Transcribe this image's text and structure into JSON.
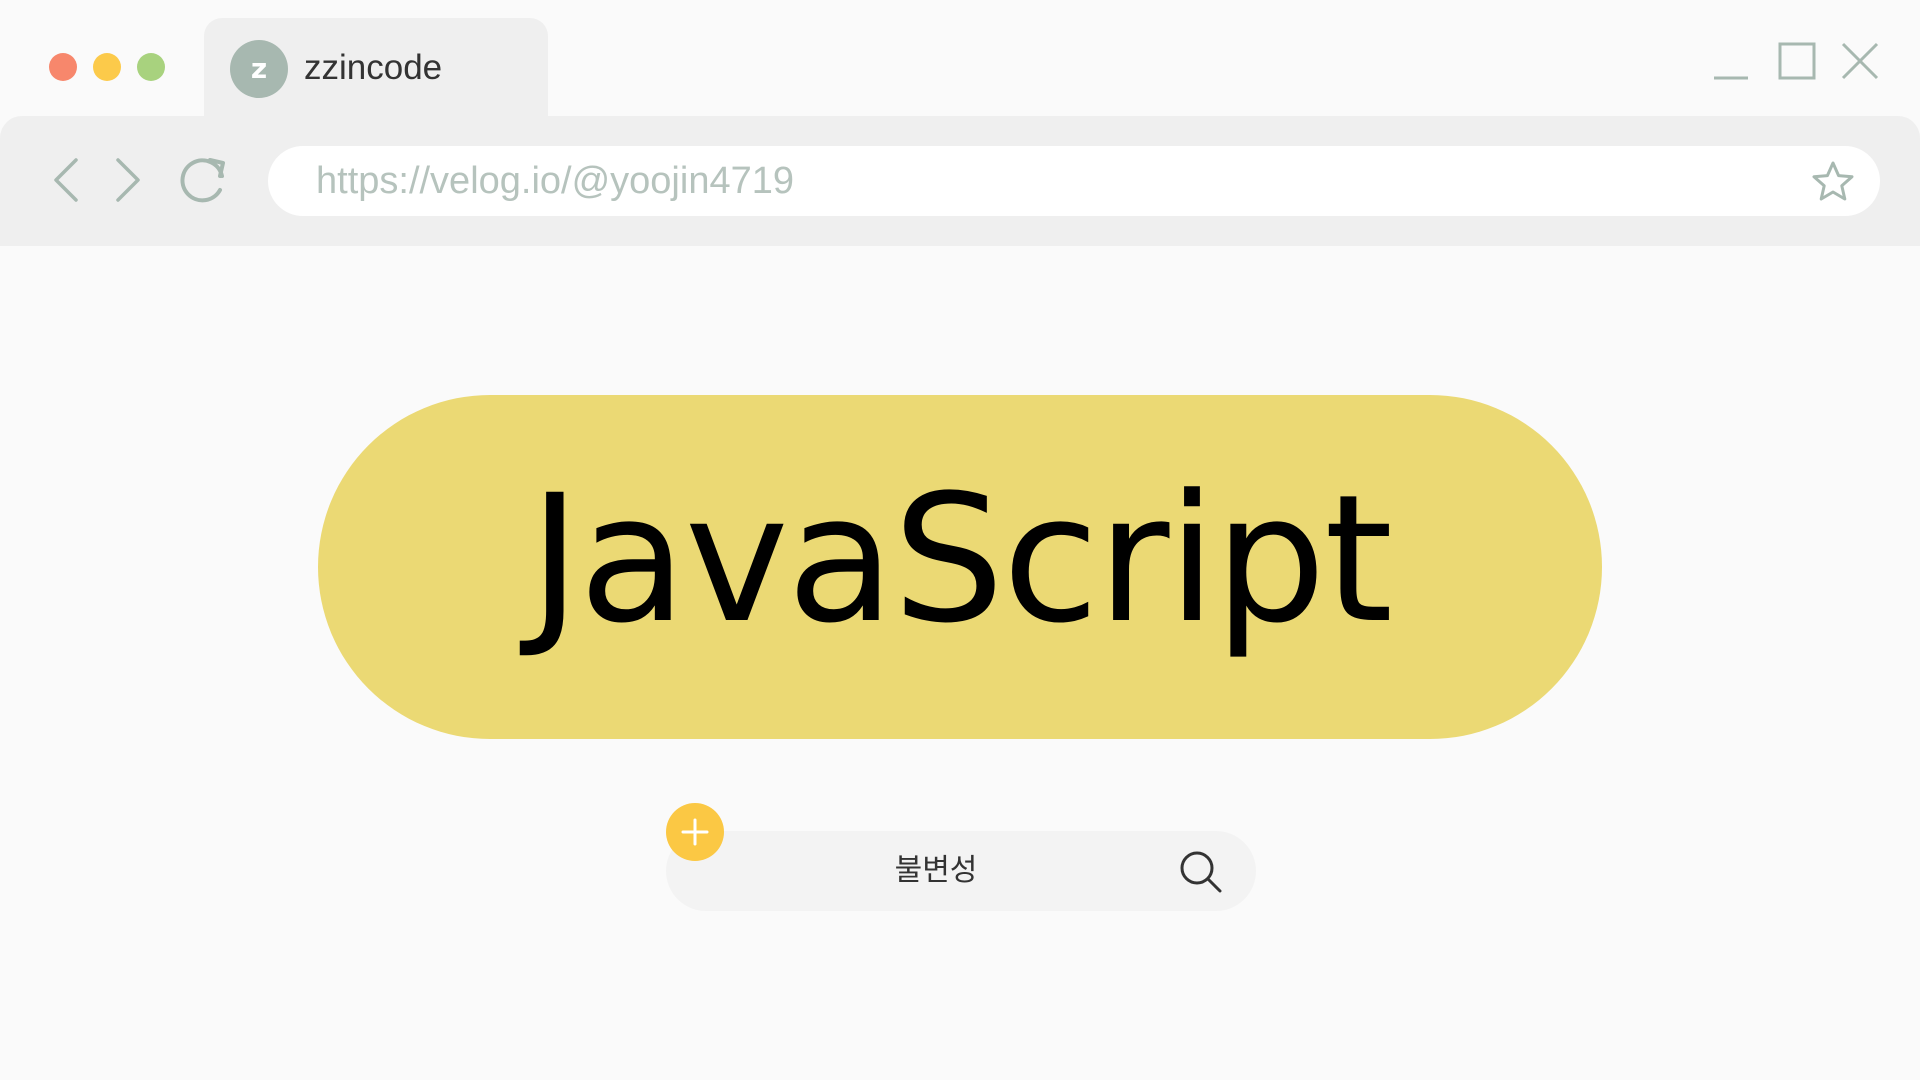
{
  "window": {
    "traffic_lights": [
      "close",
      "minimize",
      "zoom"
    ],
    "controls": [
      "minimize-icon",
      "maximize-icon",
      "close-icon"
    ]
  },
  "tab": {
    "avatar_letter": "z",
    "title": "zzincode"
  },
  "toolbar": {
    "nav_icons": [
      "back-icon",
      "forward-icon",
      "reload-icon"
    ],
    "url": "https://velog.io/@yoojin4719",
    "bookmark_icon": "star-icon"
  },
  "hero": {
    "title": "JavaScript"
  },
  "search": {
    "value": "불변성",
    "icon": "search-icon",
    "add_icon": "plus-icon"
  },
  "colors": {
    "traffic_red": "#f7876c",
    "traffic_yellow": "#fcca4a",
    "traffic_green": "#a8d27e",
    "hero_background": "#ebd974",
    "add_button": "#fbc844",
    "icon_gray": "#a7b8b0"
  }
}
